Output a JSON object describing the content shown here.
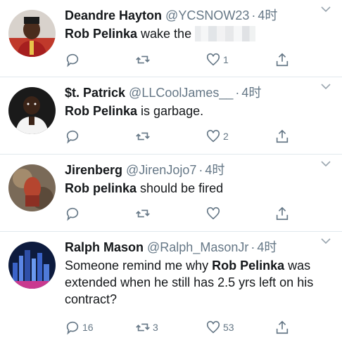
{
  "tweets": [
    {
      "name": "Deandre Hayton",
      "handle": "@YCSNOW23",
      "separator": "·",
      "time": "4时",
      "mention": "Rob Pelinka",
      "text_before": "",
      "text_after": " wake the",
      "reply_count": "",
      "retweet_count": "",
      "like_count": "1"
    },
    {
      "name": "$t. Patrick",
      "handle": "@LLCoolJames__",
      "separator": "·",
      "time": "4时",
      "mention": "Rob Pelinka",
      "text_before": "",
      "text_after": " is garbage.",
      "reply_count": "",
      "retweet_count": "",
      "like_count": "2"
    },
    {
      "name": "Jirenberg",
      "handle": "@JirenJojo7",
      "separator": "·",
      "time": "4时",
      "mention": "Rob pelinka",
      "text_before": "",
      "text_after": " should be fired",
      "reply_count": "",
      "retweet_count": "",
      "like_count": ""
    },
    {
      "name": "Ralph Mason",
      "handle": "@Ralph_MasonJr",
      "separator": "·",
      "time": "4时",
      "mention": "Rob Pelinka",
      "text_before": "Someone remind me why ",
      "text_after": " was extended when he still has 2.5 yrs left on his contract?",
      "reply_count": "16",
      "retweet_count": "3",
      "like_count": "53"
    }
  ],
  "icons": {
    "reply": "reply-icon",
    "retweet": "retweet-icon",
    "like": "heart-icon",
    "share": "share-icon",
    "menu": "chevron-down-icon"
  },
  "colors": {
    "text": "#14171a",
    "secondary": "#657786",
    "divider": "#e1e8ed"
  }
}
